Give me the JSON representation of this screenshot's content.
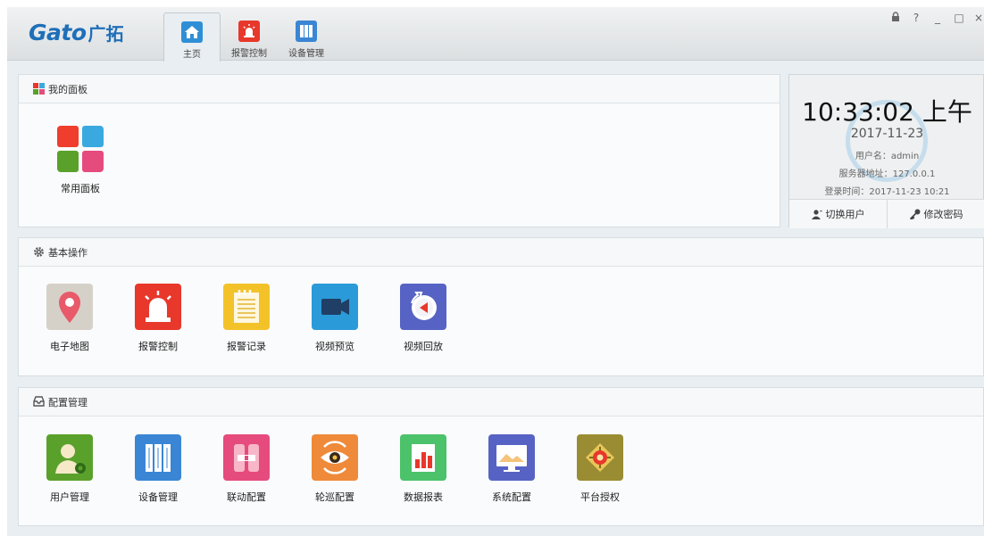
{
  "app": {
    "logo_latin": "Gato",
    "logo_cn": "广拓"
  },
  "tabs": [
    {
      "label": "主页",
      "icon": "home-icon",
      "color": "#2f8fd6"
    },
    {
      "label": "报警控制",
      "icon": "alarm-icon",
      "color": "#e8372b"
    },
    {
      "label": "设备管理",
      "icon": "device-icon",
      "color": "#3a86d4"
    }
  ],
  "window_controls": {
    "lock": "🔒",
    "help": "?",
    "minimize": "_",
    "maximize": "□",
    "close": "×"
  },
  "my_panel": {
    "title": "我的面板",
    "items": [
      {
        "label": "常用面板",
        "icon": "common-panel-icon"
      }
    ]
  },
  "clock": {
    "time": "10:33:02 上午",
    "date": "2017-11-23",
    "username": "用户名：admin",
    "server": "服务器地址：127.0.0.1",
    "login_time": "登录时间：2017-11-23 10:21",
    "switch_user": "切换用户",
    "change_password": "修改密码"
  },
  "basic_ops": {
    "title": "基本操作",
    "items": [
      {
        "label": "电子地图",
        "icon": "map-pin-icon"
      },
      {
        "label": "报警控制",
        "icon": "alarm-icon"
      },
      {
        "label": "报警记录",
        "icon": "notepad-icon"
      },
      {
        "label": "视频预览",
        "icon": "video-camera-icon"
      },
      {
        "label": "视频回放",
        "icon": "playback-icon"
      }
    ]
  },
  "config": {
    "title": "配置管理",
    "items": [
      {
        "label": "用户管理",
        "icon": "user-settings-icon"
      },
      {
        "label": "设备管理",
        "icon": "device-icon"
      },
      {
        "label": "联动配置",
        "icon": "linkage-icon"
      },
      {
        "label": "轮巡配置",
        "icon": "patrol-eye-icon"
      },
      {
        "label": "数据报表",
        "icon": "bar-chart-icon"
      },
      {
        "label": "系统配置",
        "icon": "monitor-icon"
      },
      {
        "label": "平台授权",
        "icon": "authorization-icon"
      }
    ]
  },
  "colors": {
    "brand": "#1f6fb8",
    "red": "#e8372b",
    "blue": "#3a86d4",
    "green": "#5aa12b",
    "pink": "#e64b7d"
  }
}
